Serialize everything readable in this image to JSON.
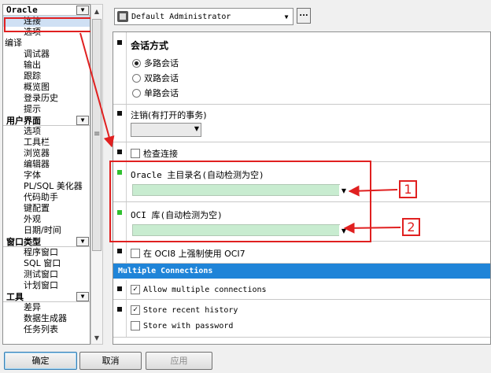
{
  "tree": {
    "cat_oracle": "Oracle",
    "oracle_items": [
      "连接",
      "选项"
    ],
    "compile_label": "编译",
    "debug_items": [
      "调试器",
      "输出",
      "跟踪",
      "概览图",
      "登录历史",
      "提示"
    ],
    "cat_ui": "用户界面",
    "ui_items": [
      "选项",
      "工具栏",
      "浏览器",
      "编辑器",
      "字体",
      "PL/SQL 美化器",
      "代码助手",
      "键配置",
      "外观",
      "日期/时间"
    ],
    "cat_window": "窗口类型",
    "window_items": [
      "程序窗口",
      "SQL 窗口",
      "测试窗口",
      "计划窗口"
    ],
    "cat_tools": "工具",
    "tools_items": [
      "差异",
      "数据生成器",
      "任务列表"
    ]
  },
  "toolbar": {
    "profile_value": "Default Administrator",
    "dots_label": "..."
  },
  "session": {
    "title": "会话方式",
    "options": [
      "多路会话",
      "双路会话",
      "单路会话"
    ],
    "selected_index": 0
  },
  "logoff": {
    "label": "注销(有打开的事务)"
  },
  "check_connection": {
    "label": "检查连接"
  },
  "oracle_home": {
    "label": "Oracle 主目录名(自动检测为空)"
  },
  "oci_library": {
    "label": "OCI 库(自动检测为空)"
  },
  "oci8": {
    "label": "在 OCI8 上强制使用 OCI7"
  },
  "multiple": {
    "band": "Multiple Connections",
    "allow_label": "Allow multiple connections",
    "allow_checked": true
  },
  "history": {
    "store_recent_label": "Store recent history",
    "store_recent_checked": true,
    "store_password_label": "Store with password",
    "store_password_checked": false
  },
  "annotations": {
    "num1": "1",
    "num2": "2",
    "color": "#e02020"
  },
  "buttons": {
    "ok": "确定",
    "cancel": "取消",
    "apply": "应用"
  }
}
